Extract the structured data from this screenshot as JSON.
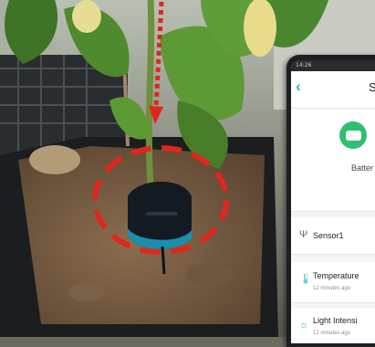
{
  "app": {
    "status_time": "14:26",
    "title_fragment": "S",
    "battery_label": "Batter"
  },
  "rows": [
    {
      "icon": "probe-icon",
      "label": "Sensor1",
      "sub": ""
    },
    {
      "icon": "thermometer-icon",
      "label": "Temperature",
      "sub": "12 minutes ago"
    },
    {
      "icon": "sun-icon",
      "label": "Light Intensi",
      "sub": "12 minutes ago"
    }
  ],
  "colors": {
    "accent": "#1fb6c7",
    "battery_ok": "#2fbf71",
    "highlight": "#e0261e"
  }
}
